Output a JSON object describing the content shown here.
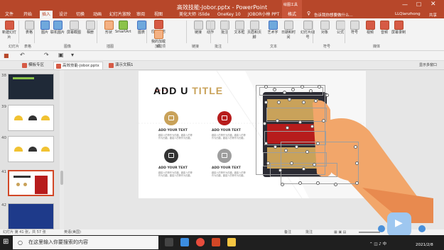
{
  "app": {
    "title": "高效技能-Jobor.pptx - PowerPoint",
    "context_tool": "绘图工具",
    "account": "LLQianzhong",
    "share": "共享",
    "search_hint": "操作说明搜索",
    "tell_me": "告诉我你想要做什么..."
  },
  "ribbon": {
    "tabs": [
      "文件",
      "开始",
      "插入",
      "设计",
      "切换",
      "动画",
      "幻灯片放映",
      "审阅",
      "视图",
      "美化大师",
      "iSlide",
      "OneKey 10",
      "JOBOR小林 PPT",
      "格式"
    ],
    "active_tab": "插入",
    "buttons": [
      {
        "label": "新建幻灯片",
        "icon": "new-slide-icon"
      },
      {
        "label": "表格",
        "icon": "table-icon"
      },
      {
        "label": "图片",
        "icon": "picture-icon"
      },
      {
        "label": "联机图片",
        "icon": "online-picture-icon"
      },
      {
        "label": "屏幕截图",
        "icon": "screenshot-icon"
      },
      {
        "label": "相册",
        "icon": "album-icon"
      },
      {
        "label": "形状",
        "icon": "shapes-icon"
      },
      {
        "label": "SmartArt",
        "icon": "smartart-icon"
      },
      {
        "label": "图表",
        "icon": "chart-icon"
      },
      {
        "label": "应用商店",
        "icon": "store-icon"
      },
      {
        "label": "我的加载项",
        "icon": "addin-icon"
      },
      {
        "label": "链接",
        "icon": "link-icon"
      },
      {
        "label": "动作",
        "icon": "action-icon"
      },
      {
        "label": "批注",
        "icon": "comment-icon"
      },
      {
        "label": "文本框",
        "icon": "textbox-icon"
      },
      {
        "label": "页眉和页脚",
        "icon": "header-footer-icon"
      },
      {
        "label": "艺术字",
        "icon": "wordart-icon"
      },
      {
        "label": "日期和时间",
        "icon": "datetime-icon"
      },
      {
        "label": "幻灯片编号",
        "icon": "slide-number-icon"
      },
      {
        "label": "对象",
        "icon": "object-icon"
      },
      {
        "label": "公式",
        "icon": "equation-icon"
      },
      {
        "label": "符号",
        "icon": "symbol-icon"
      },
      {
        "label": "视频",
        "icon": "video-icon"
      },
      {
        "label": "音频",
        "icon": "audio-icon"
      },
      {
        "label": "屏幕录制",
        "icon": "screen-record-icon"
      }
    ],
    "groups": [
      "幻灯片",
      "表格",
      "图像",
      "插图",
      "加载项",
      "链接",
      "批注",
      "文本",
      "符号",
      "媒体"
    ]
  },
  "doc_tabs": {
    "items": [
      "模板专区",
      "高效技能-Jobor.pptx",
      "演示文稿1"
    ],
    "active": 1,
    "right_label": "显示多窗口"
  },
  "thumbnails": [
    {
      "num": "38"
    },
    {
      "num": "39"
    },
    {
      "num": "40"
    },
    {
      "num": "41"
    },
    {
      "num": "42"
    }
  ],
  "slide": {
    "title_part1": "ADD U ",
    "title_part2": "TITLE",
    "items": [
      {
        "heading": "ADD YOUR TEXT",
        "body": "趣能人的等作为的趣。趣能人的等作为的趣。趣能人的等作为的趣。",
        "color": "#c9a25a"
      },
      {
        "heading": "ADD YOUR TEXT",
        "body": "趣能人的等作为的趣。趣能人的等作为的趣。趣能人的等作为的趣。",
        "color": "#b71c1c"
      },
      {
        "heading": "ADD YOUR TEXT",
        "body": "趣能人的等作为的趣。趣能人的等作为的趣。趣能人的等作为的趣。",
        "color": "#333333"
      },
      {
        "heading": "ADD YOUR TEXT",
        "body": "趣能人的等作为的趣。趣能人的等作为的趣。趣能人的等作为的趣。",
        "color": "#9e9e9e"
      }
    ]
  },
  "status": {
    "left": "幻灯片 第 41 张，共 57 张",
    "lang": "英语(美国)",
    "notes": "备注",
    "comments": "批注"
  },
  "taskbar": {
    "search_placeholder": "在这里输入你要搜索的内容",
    "time": "2021/2/8"
  },
  "colors": {
    "brand": "#b7472a",
    "gold": "#c9a25a",
    "red": "#b71c1c"
  }
}
